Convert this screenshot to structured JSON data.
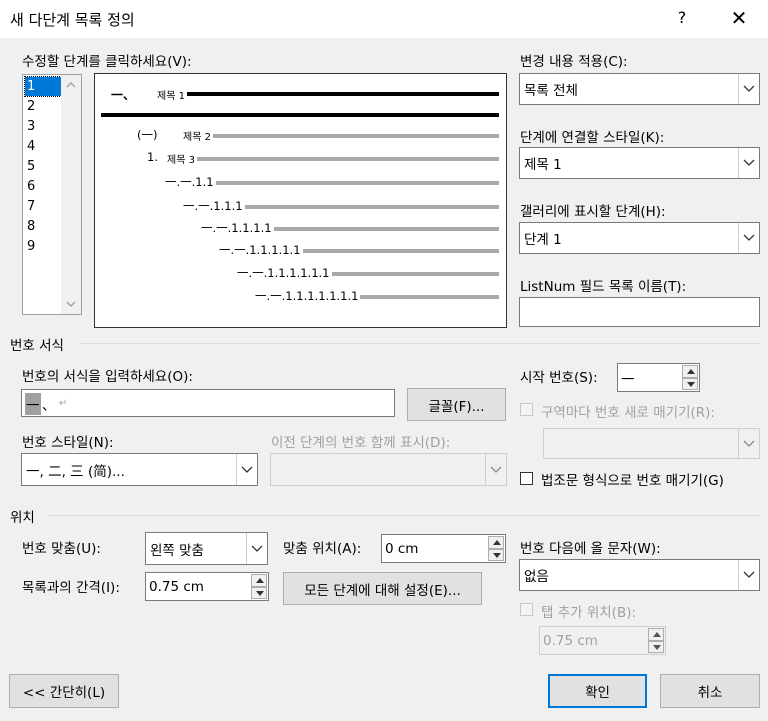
{
  "window": {
    "title": "새 다단계 목록 정의",
    "help": "?",
    "close": "✕"
  },
  "levels_section": {
    "label": "수정할 단계를 클릭하세요(V):",
    "levels": [
      "1",
      "2",
      "3",
      "4",
      "5",
      "6",
      "7",
      "8",
      "9"
    ],
    "selected": "1"
  },
  "preview": {
    "items": [
      {
        "num": "一、",
        "text": "제목 1",
        "bold": true
      },
      {
        "num": "(一)",
        "text": "제목 2"
      },
      {
        "num": "1.",
        "text": "제목 3"
      },
      {
        "num": "一.一.1.1",
        "text": ""
      },
      {
        "num": "一.一.1.1.1",
        "text": ""
      },
      {
        "num": "一.一.1.1.1.1",
        "text": ""
      },
      {
        "num": "一.一.1.1.1.1.1",
        "text": ""
      },
      {
        "num": "一.一.1.1.1.1.1.1",
        "text": ""
      },
      {
        "num": "一.一.1.1.1.1.1.1.1",
        "text": ""
      }
    ]
  },
  "apply_changes": {
    "label": "변경 내용 적용(C):",
    "value": "목록 전체"
  },
  "link_style": {
    "label": "단계에 연결할 스타일(K):",
    "value": "제목 1"
  },
  "gallery_level": {
    "label": "갤러리에 표시할 단계(H):",
    "value": "단계 1"
  },
  "listnum": {
    "label": "ListNum 필드 목록 이름(T):",
    "value": ""
  },
  "number_format": {
    "section": "번호 서식",
    "format_label": "번호의 서식을 입력하세요(O):",
    "format_value_highlight": "一",
    "format_value_rest": "、",
    "para_mark": "↵",
    "font_button": "글꼴(F)...",
    "style_label": "번호 스타일(N):",
    "style_value": "一, 二, 三 (简)...",
    "include_label": "이전 단계의 번호 함께 표시(D):",
    "include_value": "",
    "start_label": "시작 번호(S):",
    "start_value": "一",
    "restart_label": "구역마다 번호 새로 매기기(R):",
    "restart_value": "",
    "legal_label": "법조문 형식으로 번호 매기기(G)"
  },
  "position": {
    "section": "위치",
    "align_label": "번호 맞춤(U):",
    "align_value": "왼쪽 맞춤",
    "align_at_label": "맞춤 위치(A):",
    "align_at_value": "0 cm",
    "indent_label": "목록과의 간격(I):",
    "indent_value": "0.75 cm",
    "set_all_button": "모든 단계에 대해 설정(E)...",
    "follow_label": "번호 다음에 올 문자(W):",
    "follow_value": "없음",
    "tab_label": "탭 추가 위치(B):",
    "tab_value": "0.75 cm"
  },
  "footer": {
    "less": "<< 간단히(L)",
    "ok": "확인",
    "cancel": "취소"
  }
}
